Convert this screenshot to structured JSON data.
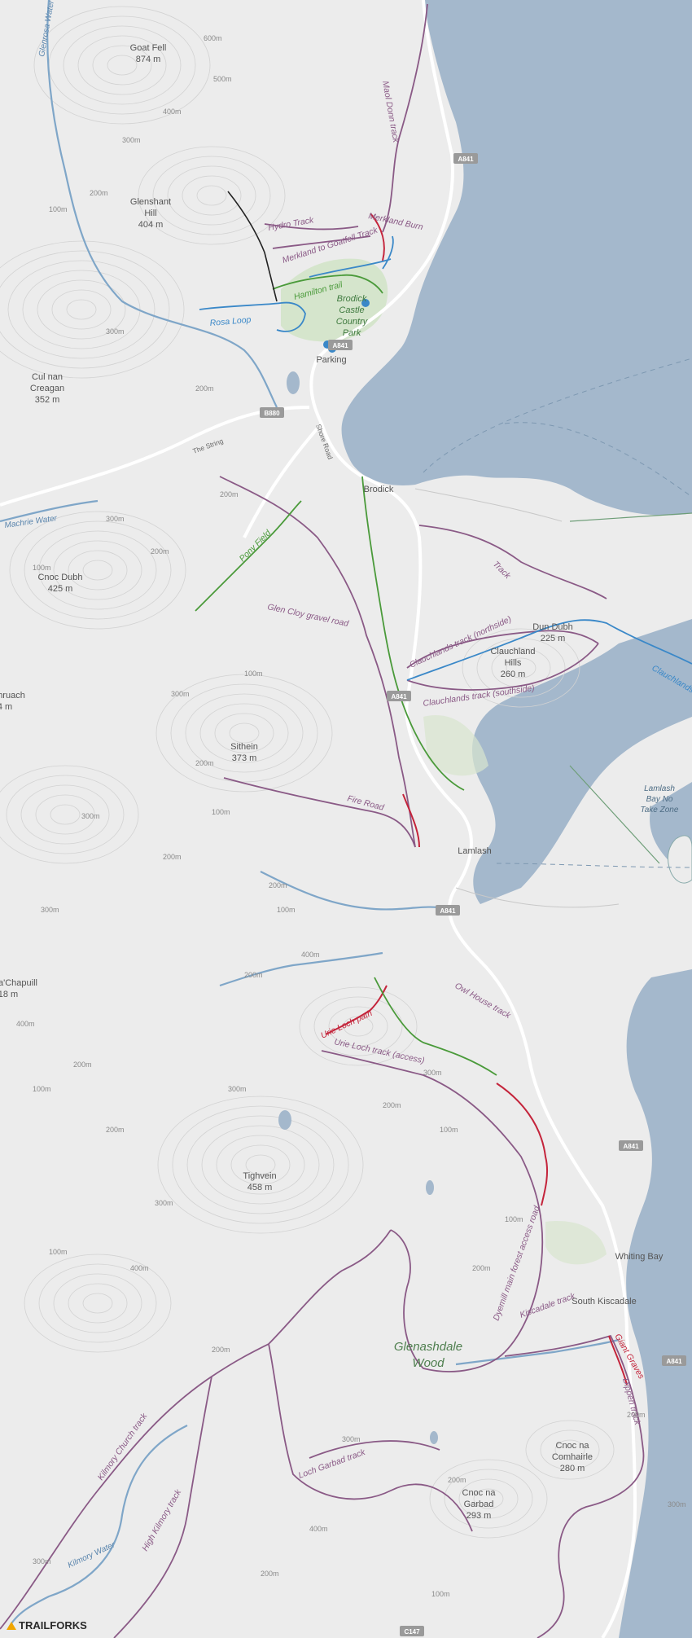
{
  "colors": {
    "land": "#ececec",
    "sea": "#a4b8cc",
    "contour": "#cfcfcf",
    "trail_purple": "#8a5a86",
    "trail_red": "#c4243b",
    "trail_green": "#4a9a3a",
    "trail_blue": "#3a88c8",
    "trail_black": "#222222",
    "road": "#ffffff",
    "water_stream": "#7fa6c8",
    "park": "#cfe3c4",
    "boundary": "#6e9e78",
    "shield_bg": "#9a9a9a"
  },
  "places": {
    "goat_fell": "Goat Fell",
    "goat_fell_h": "874 m",
    "glenshant": "Glenshant",
    "glenshant2": "Hill",
    "glenshant_h": "404 m",
    "cul_nan": "Cul nan",
    "creagan": "Creagan",
    "cul_h": "352 m",
    "cnoc_dubh": "Cnoc Dubh",
    "cnoc_dubh_h": "425 m",
    "shruach": "hruach",
    "shruach_h": "4 m",
    "sithein": "Sithein",
    "sithein_h": "373 m",
    "chapuill": "a'Chapuill",
    "chapuill_h": "18 m",
    "tighvein": "Tighvein",
    "tighvein_h": "458 m",
    "brodick": "Brodick",
    "dun_dubh": "Dun Dubh",
    "dun_dubh_h": "225 m",
    "clauchland": "Clauchland",
    "clauchland2": "Hills",
    "clauchland_h": "260 m",
    "lamlash": "Lamlash",
    "whiting_bay": "Whiting Bay",
    "south_kiscadale": "South Kiscadale",
    "glenashdale": "Glenashdale",
    "glenashdale2": "Wood",
    "cnoc_garbad": "Cnoc na",
    "cnoc_garbad2": "Garbad",
    "cnoc_garbad_h": "293 m",
    "cnoc_comhairle": "Cnoc na",
    "cnoc_comhairle2": "Comhairle",
    "cnoc_comhairle_h": "280 m",
    "brodick_castle": "Brodick",
    "brodick_castle2": "Castle",
    "brodick_castle3": "Country",
    "brodick_castle4": "Park",
    "parking": "Parking",
    "lamlash_bay": "Lamlash",
    "lamlash_bay2": "Bay No",
    "lamlash_bay3": "Take Zone"
  },
  "water": {
    "glenrosa": "Glenrosa Water",
    "machrie": "Machrie Water",
    "kilmory": "Kilmory Water"
  },
  "roads": {
    "a841_1": "A841",
    "a841_2": "A841",
    "a841_3": "A841",
    "a841_4": "A841",
    "a841_5": "A841",
    "a841_6": "A841",
    "b880": "B880",
    "c147": "C147",
    "the_string": "The String",
    "shore_road": "Shore Road"
  },
  "trails": {
    "maol_donn": "Maol Donn track",
    "hydro": "Hydro Track",
    "merkland_goatfell": "Merkland to Goatfell Track",
    "merkland_burn": "Merkland Burn",
    "hamilton": "Hamilton trail",
    "rosa_loop": "Rosa Loop",
    "pony_field": "Pony Field",
    "glen_cloy": "Glen Cloy gravel road",
    "track": "Track",
    "clauchlands_north": "Clauchlands track (northside)",
    "clauchlands_south": "Clauchlands track (southside)",
    "clauchlands": "Clauchlands",
    "fire_road": "Fire Road",
    "urie_loch_path": "Urie Loch path",
    "urie_loch_access": "Urie Loch track (access)",
    "owl_house": "Owl House track",
    "dyemill": "Dyemill main forest access road",
    "kiscadale": "Kiscadale track",
    "giants_graves": "Giant Graves",
    "dippen": "Dippen track",
    "kilmory_church": "Kilmory Church track",
    "loch_garbad": "Loch Garbad track",
    "high_kilmory": "High Kilmory track"
  },
  "contours": {
    "c1": "600m",
    "c2": "500m",
    "c3": "400m",
    "c4": "300m",
    "c5": "200m",
    "c6": "100m",
    "c7": "300m",
    "c8": "200m",
    "c9": "100m",
    "c10": "200m",
    "c11": "300m",
    "c12": "100m",
    "c13": "200m",
    "c14": "300m",
    "c15": "200m",
    "c16": "100m",
    "c17": "300m",
    "c18": "200m",
    "c19": "100m",
    "c20": "300m",
    "c21": "400m",
    "c22": "200m",
    "c23": "100m",
    "c24": "200m",
    "c25": "300m",
    "c26": "200m",
    "c27": "400m",
    "c28": "200m",
    "c29": "300m",
    "c30": "100m",
    "c31": "200m",
    "c32": "100m",
    "c33": "300m",
    "c34": "200m",
    "c35": "400m",
    "c36": "300m",
    "c37": "200m",
    "c38": "100m",
    "c39": "200m",
    "c40": "300m",
    "c41": "400m",
    "c42": "200m",
    "c43": "300m",
    "c44": "100m",
    "c45": "200m"
  },
  "sea_labels": {},
  "brand": "TRAILFORKS"
}
